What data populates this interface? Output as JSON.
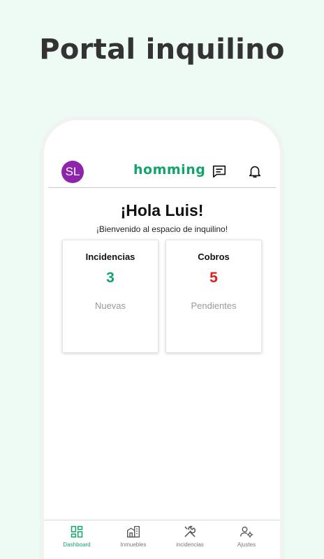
{
  "headline": "Portal inquilino",
  "header": {
    "avatar_initials": "SL",
    "brand": "homming",
    "icons": [
      "chat-icon",
      "bell-icon"
    ]
  },
  "greeting": {
    "title": "¡Hola Luis!",
    "subtitle": "¡Bienvenido al espacio de inquilino!"
  },
  "cards": [
    {
      "title": "Incidencias",
      "value": "3",
      "sub": "Nuevas",
      "color": "#13a36b"
    },
    {
      "title": "Cobros",
      "value": "5",
      "sub": "Pendientes",
      "color": "#e0201c"
    }
  ],
  "nav": [
    {
      "label": "Dashboard",
      "icon": "dashboard-icon",
      "active": true
    },
    {
      "label": "Inmuebles",
      "icon": "buildings-icon",
      "active": false
    },
    {
      "label": "incidencias",
      "icon": "tools-icon",
      "active": false
    },
    {
      "label": "Ajustes",
      "icon": "user-settings-icon",
      "active": false
    }
  ],
  "colors": {
    "accent": "#13a36b",
    "avatar": "#8e24aa",
    "alert": "#e0201c",
    "background": "#eefaf4"
  }
}
